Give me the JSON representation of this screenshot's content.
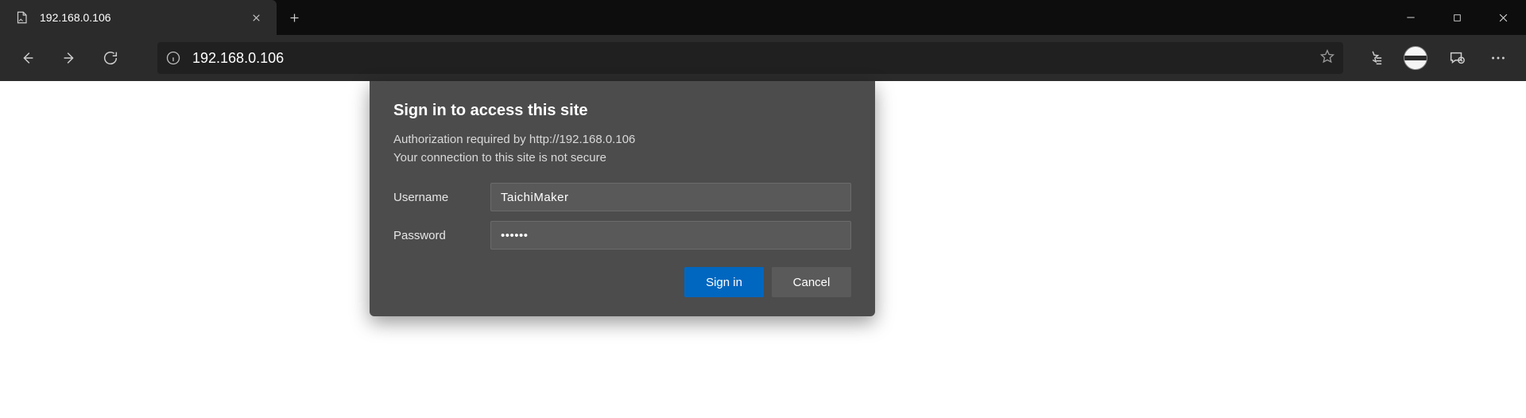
{
  "tab": {
    "title": "192.168.0.106"
  },
  "address": {
    "url": "192.168.0.106"
  },
  "dialog": {
    "title": "Sign in to access this site",
    "line1": "Authorization required by http://192.168.0.106",
    "line2": "Your connection to this site is not secure",
    "username_label": "Username",
    "password_label": "Password",
    "username_value": "TaichiMaker",
    "password_value": "••••••",
    "signin_label": "Sign in",
    "cancel_label": "Cancel"
  },
  "colors": {
    "accent": "#0067c0"
  }
}
